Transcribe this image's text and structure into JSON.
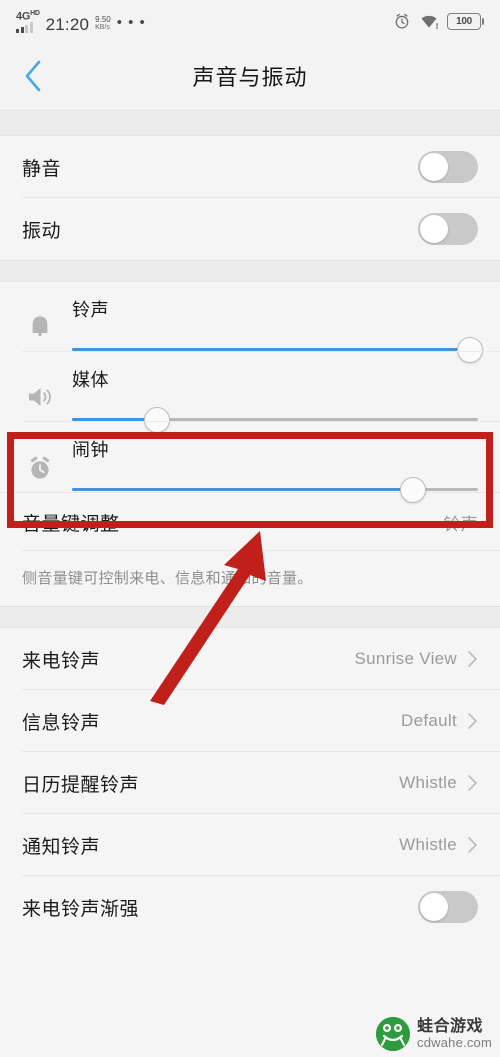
{
  "status_bar": {
    "network_type": "4G",
    "network_sup": "HD",
    "time": "21:20",
    "data_rate_value": "9.50",
    "data_rate_unit": "KB/s",
    "overflow_dots": "• • •",
    "alarm_icon": "alarm-clock-icon",
    "wifi_icon": "wifi-icon",
    "battery_level": "100"
  },
  "header": {
    "back_icon": "chevron-left-icon",
    "title": "声音与振动"
  },
  "toggles_section": [
    {
      "label": "静音",
      "state": "off"
    },
    {
      "label": "振动",
      "state": "off"
    }
  ],
  "sliders_section": [
    {
      "label": "铃声",
      "icon": "bell-icon",
      "percent": 98
    },
    {
      "label": "媒体",
      "icon": "speaker-icon",
      "percent": 21
    },
    {
      "label": "闹钟",
      "icon": "alarm-clock-icon",
      "percent": 84,
      "highlighted": true
    }
  ],
  "volume_key": {
    "label": "音量键调整",
    "value": "铃声",
    "description": "侧音量键可控制来电、信息和通知的音量。"
  },
  "ringtone_rows": [
    {
      "label": "来电铃声",
      "value": "Sunrise View",
      "chevron": "chevron-right-icon"
    },
    {
      "label": "信息铃声",
      "value": "Default",
      "chevron": "chevron-right-icon"
    },
    {
      "label": "日历提醒铃声",
      "value": "Whistle",
      "chevron": "chevron-right-icon"
    },
    {
      "label": "通知铃声",
      "value": "Whistle",
      "chevron": "chevron-right-icon"
    }
  ],
  "bottom_toggle": {
    "label": "来电铃声渐强",
    "state": "off"
  },
  "watermark": {
    "brand": "蛙合游戏",
    "url": "cdwahe.com",
    "logo_icon": "frog-logo-icon"
  },
  "annotations": {
    "highlight_color": "#c1201a",
    "arrow_icon": "red-arrow-up-right-icon"
  },
  "colors": {
    "accent": "#3b95e0",
    "back_arrow": "#4aa8e8",
    "highlight": "#c1201a",
    "page_bg": "#f5f5f5"
  }
}
